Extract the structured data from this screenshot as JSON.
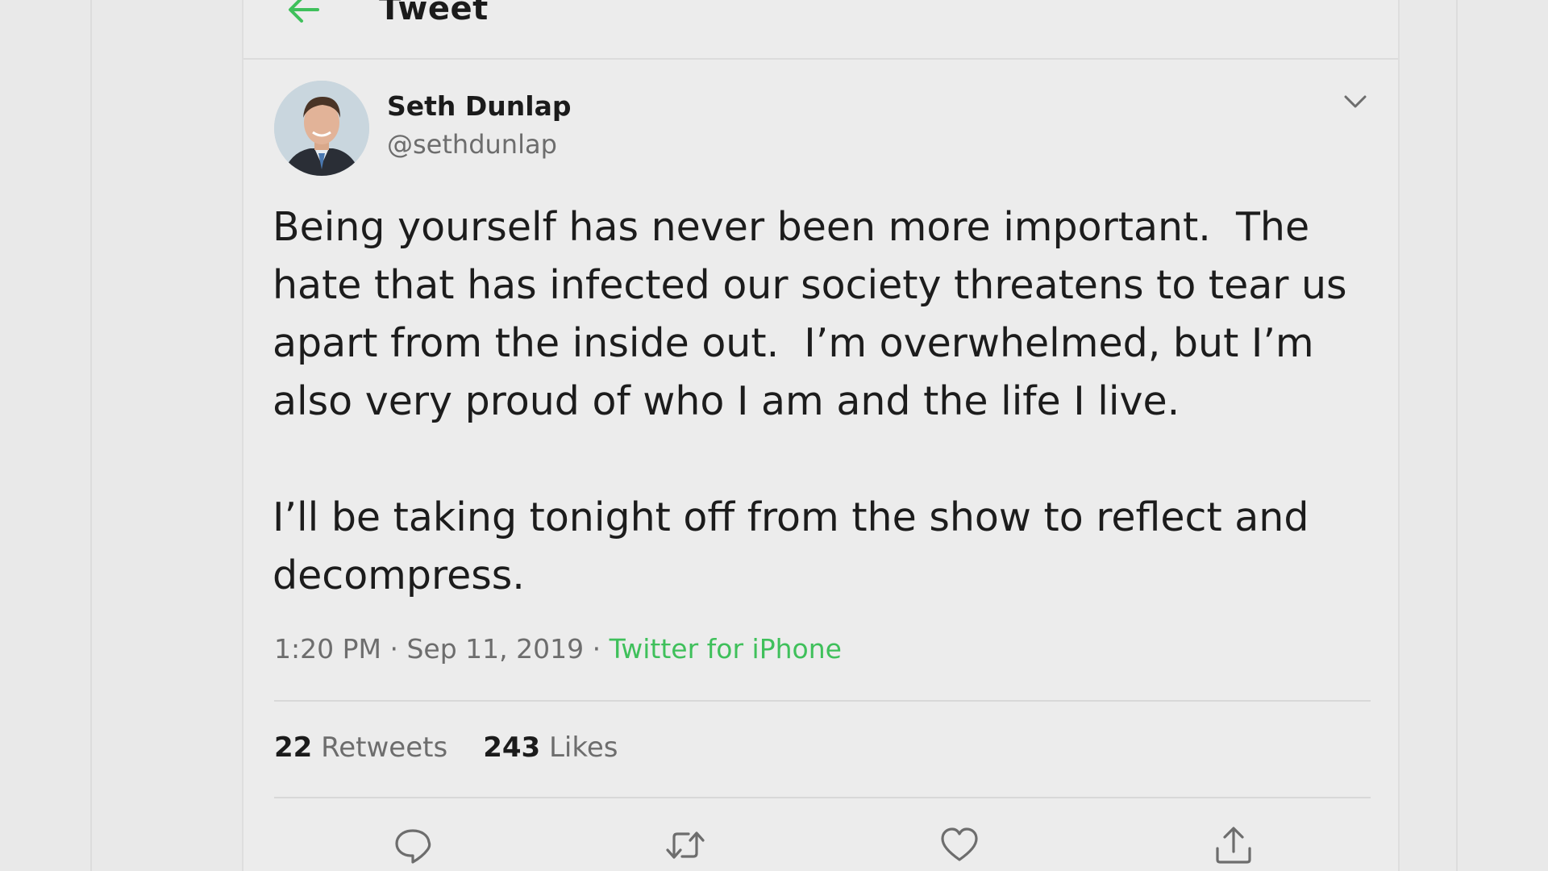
{
  "header": {
    "title": "Tweet",
    "back_icon": "arrow-left-icon",
    "accent_color": "#3fc05b"
  },
  "tweet": {
    "author_name": "Seth Dunlap",
    "author_handle": "@sethdunlap",
    "text": "Being yourself has never been more important.  The\nhate that has infected our society threatens to tear us\napart from the inside out.  I’m overwhelmed, but I’m\nalso very proud of who I am and the life I live.\n\nI’ll be taking tonight off from the show to reflect and\ndecompress.",
    "time": "1:20 PM",
    "separator1": " · ",
    "date": "Sep 11, 2019",
    "separator2": " · ",
    "source": "Twitter for iPhone",
    "retweets_count": "22",
    "retweets_label": "Retweets",
    "likes_count": "243",
    "likes_label": "Likes"
  },
  "actions": {
    "reply_icon": "reply-icon",
    "retweet_icon": "retweet-icon",
    "like_icon": "heart-icon",
    "share_icon": "share-icon"
  }
}
